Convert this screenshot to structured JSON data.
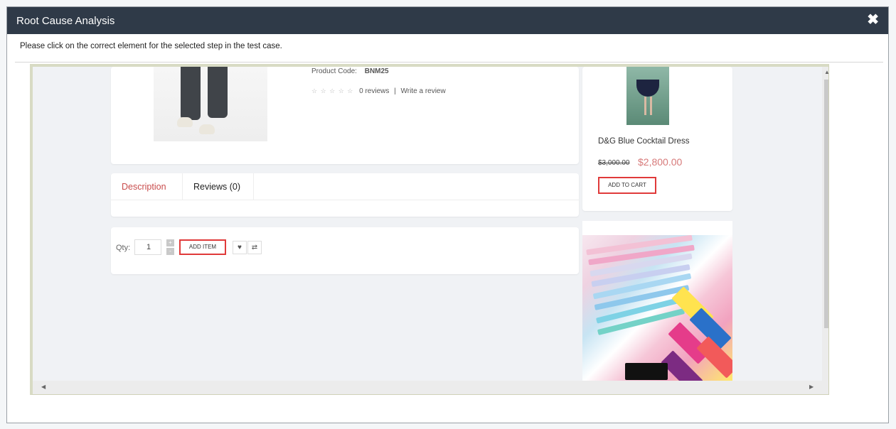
{
  "modal": {
    "title": "Root Cause Analysis",
    "close_icon": "close-icon",
    "instruction": "Please click on the correct element for the selected step in the test case."
  },
  "product": {
    "code_label": "Product Code:",
    "code_value": "BNM25",
    "reviews_count": "0 reviews",
    "separator": "|",
    "write_review": "Write a review",
    "stars": "☆ ☆ ☆ ☆ ☆"
  },
  "tabs": [
    {
      "label": "Description",
      "active": true
    },
    {
      "label": "Reviews (0)",
      "active": false
    }
  ],
  "cart": {
    "qty_label": "Qty:",
    "qty_value": "1",
    "qty_increase": "+",
    "qty_decrease": "-",
    "add_item_label": "ADD ITEM",
    "wishlist_icon": "heart-icon",
    "compare_icon": "compare-icon"
  },
  "sidebar_product": {
    "name": "D&G Blue Cocktail Dress",
    "old_price": "$3,000.00",
    "new_price": "$2,800.00",
    "add_to_cart_label": "ADD TO CART"
  },
  "colors": {
    "header_bg": "#2f3a48",
    "highlight_border": "#e03a3a",
    "active_tab": "#c94c4c",
    "sale_price": "#d77a7a"
  }
}
